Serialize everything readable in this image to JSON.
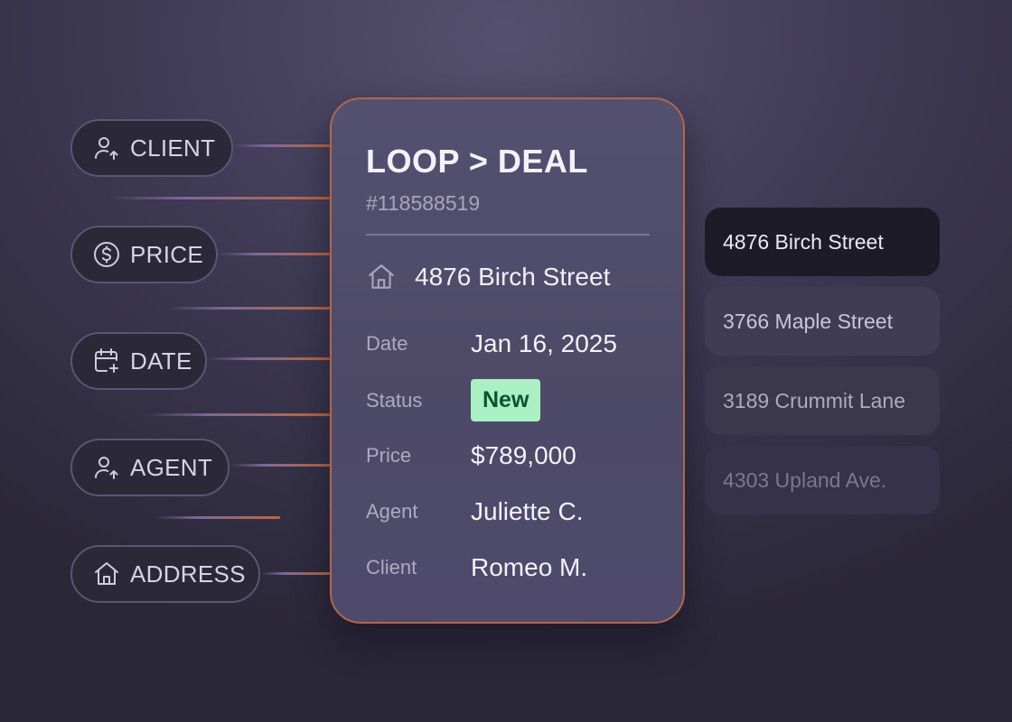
{
  "fields": [
    {
      "label": "CLIENT",
      "icon": "user-up-icon"
    },
    {
      "label": "PRICE",
      "icon": "dollar-circle-icon"
    },
    {
      "label": "DATE",
      "icon": "calendar-plus-icon"
    },
    {
      "label": "AGENT",
      "icon": "user-up-icon"
    },
    {
      "label": "ADDRESS",
      "icon": "home-icon"
    }
  ],
  "card": {
    "title": "LOOP > DEAL",
    "id": "#118588519",
    "address": "4876 Birch Street",
    "rows": [
      {
        "key": "Date",
        "value": "Jan 16, 2025"
      },
      {
        "key": "Status",
        "value": "New"
      },
      {
        "key": "Price",
        "value": "$789,000"
      },
      {
        "key": "Agent",
        "value": "Juliette C."
      },
      {
        "key": "Client",
        "value": "Romeo M."
      }
    ],
    "status_colors": {
      "background": "#abefc4",
      "text": "#10522d"
    },
    "accent_border": "#b0684a"
  },
  "addresses": [
    "4876 Birch Street",
    "3766 Maple Street",
    "3189 Crummit Lane",
    "4303 Upland Ave."
  ]
}
